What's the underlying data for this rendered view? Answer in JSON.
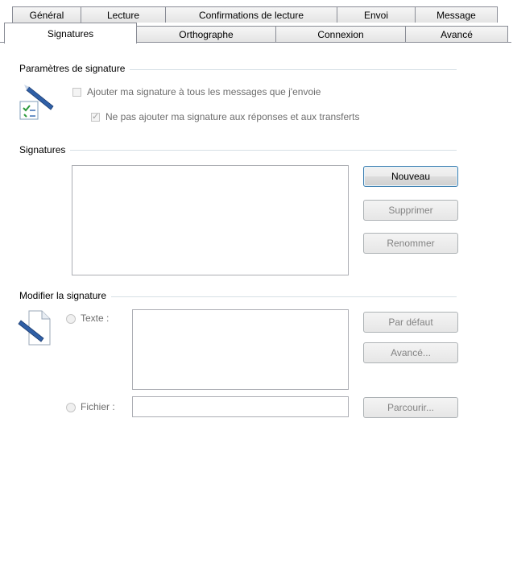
{
  "tabs_top": [
    "Général",
    "Lecture",
    "Confirmations de lecture",
    "Envoi",
    "Message"
  ],
  "tabs_bottom": [
    "Signatures",
    "Orthographe",
    "Connexion",
    "Avancé"
  ],
  "settings": {
    "group_label": "Paramètres de signature",
    "add_signature_label": "Ajouter ma signature à tous les messages que j'envoie",
    "add_signature_checked": false,
    "no_reply_label": "Ne pas ajouter ma signature aux réponses et aux transferts",
    "no_reply_checked": true
  },
  "signatures": {
    "group_label": "Signatures",
    "new_label": "Nouveau",
    "delete_label": "Supprimer",
    "rename_label": "Renommer"
  },
  "edit": {
    "group_label": "Modifier la signature",
    "text_label": "Texte :",
    "default_label": "Par défaut",
    "advanced_label": "Avancé...",
    "file_label": "Fichier :",
    "browse_label": "Parcourir..."
  }
}
